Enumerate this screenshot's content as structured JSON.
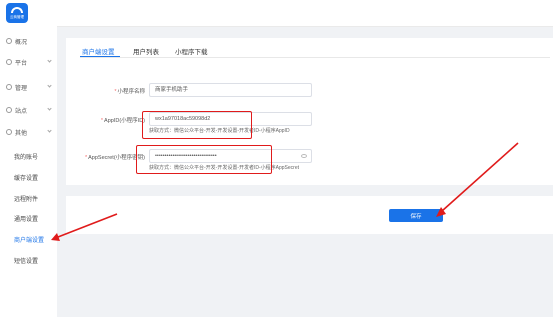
{
  "app": {
    "logo_text": "云商管理"
  },
  "sidebar": {
    "items": [
      {
        "label": "概况",
        "icon": "dashboard-icon",
        "has_chevron": false
      },
      {
        "label": "平台",
        "icon": "platform-icon",
        "has_chevron": true
      },
      {
        "label": "管理",
        "icon": "manage-icon",
        "has_chevron": true
      },
      {
        "label": "站点",
        "icon": "site-icon",
        "has_chevron": true
      },
      {
        "label": "其他",
        "icon": "other-icon",
        "has_chevron": true
      }
    ],
    "sub_items": [
      {
        "label": "我的账号",
        "active": false
      },
      {
        "label": "缓存设置",
        "active": false
      },
      {
        "label": "远程附件",
        "active": false
      },
      {
        "label": "通用设置",
        "active": false
      },
      {
        "label": "商户端设置",
        "active": true
      },
      {
        "label": "短信设置",
        "active": false
      }
    ]
  },
  "tabs": [
    {
      "label": "商户端设置",
      "active": true
    },
    {
      "label": "用户列表",
      "active": false
    },
    {
      "label": "小程序下载",
      "active": false
    }
  ],
  "form": {
    "name": {
      "label": "小程序名称",
      "value": "商家手机助手"
    },
    "appid": {
      "label": "AppID(小程序ID)",
      "value": "wx1a97018ac59098d2",
      "hint": "获取方式：微信公众平台-开发-开发设置-开发者ID-小程序AppID"
    },
    "appsecret": {
      "label": "AppSecret(小程序密钥)",
      "value": "••••••••••••••••••••••••••••••••",
      "hint": "获取方式：微信公众平台-开发-开发设置-开发者ID-小程序AppSecret"
    }
  },
  "actions": {
    "save_label": "保存"
  },
  "colors": {
    "accent": "#1a73e8",
    "highlight": "#e01b1b",
    "required": "#f56c6c"
  }
}
